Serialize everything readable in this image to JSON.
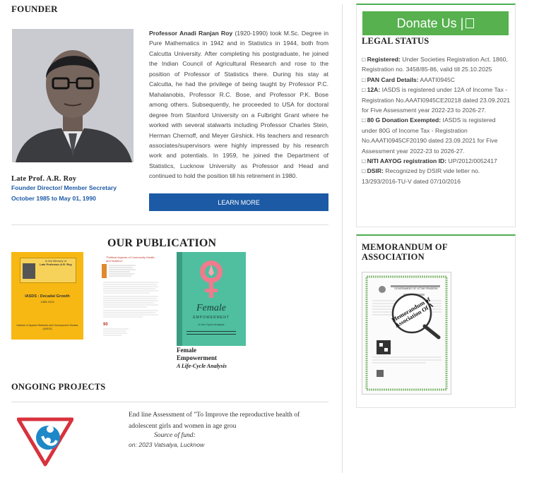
{
  "founder": {
    "heading": "FOUNDER",
    "name": "Late Prof. A.R. Roy",
    "role": "Founder Director/ Member Secretary",
    "tenure": "October 1985 to May 01, 1990",
    "bio_name": "Professor Anadi Ranjan Roy",
    "bio_text": " (1920-1990) took M.Sc. Degree in Pure Mathematics in 1942 and in Statistics in 1944, both from Calcutta University. After completing his postgraduate, he joined the Indian Council of Agricultural Research and rose to the position of Professor of Statistics there. During his stay at Calcutta, he had the privilege of being taught by Professor P.C. Mahalanobis, Professor R.C. Bose, and Professor P.K. Bose among others. Subsequently, he proceeded to USA for doctoral degree from Stanford University on a Fulbright Grant where he worked with several stalwarts including Professor Charles Stein, Herman Chernoff, and Meyer Girshick. His teachers and research associates/supervisors were highly impressed by his research work and potentials. In 1959, he joined the Department of Statistics, Lucknow University as Professor and Head and continued to hold the position till his retirement in 1980.",
    "learn_more": "LEARN MORE"
  },
  "publication": {
    "heading": "OUR PUBLICATION",
    "book1": {
      "line1": "In the Memory of",
      "line2": "Late Professor A.R. Roy",
      "title": "IASDS : Decadal Growth",
      "years": "1985-2015",
      "publisher": "Institute of Applied Statistics and Development Studies (IASDS)"
    },
    "book2": {
      "title": "\"Political Aspects of Community Health and Nutrition\""
    },
    "book3": {
      "cover_title": "Female",
      "cover_sub": "EMPOWERMENT",
      "cover_tag": "A Life Cycle Analysis",
      "caption_line1": "Female",
      "caption_line2": "Empowerment",
      "caption_line3": "A Life-Cycle Analysis"
    }
  },
  "projects": {
    "heading": "ONGOING PROJECTS",
    "item_title": "End line Assessment of \"To Improve the reproductive health of adolescent girls and women in age grou",
    "fund_label": "Source of fund:",
    "fund_value": "on: 2023 Vatsalya, Lucknow"
  },
  "donate": {
    "label": "Donate Us |",
    "icon": "heart-icon"
  },
  "legal": {
    "heading": "LEGAL STATUS",
    "items": [
      {
        "label": "Registered:",
        "text": " Under Societies Registration Act. 1860, Registration no. 3458/85-86, valid till 25.10.2025"
      },
      {
        "label": "PAN Card Details:",
        "text": " AAATI0945C"
      },
      {
        "label": "12A:",
        "text": " IASDS is registered under 12A of Income Tax - Registration No.AAATI0945CE20218 dated 23.09.2021 for Five Assessment year 2022-23 to 2026-27."
      },
      {
        "label": "80 G Donation Exempted:",
        "text": " IASDS is registered under 80G of Income Tax - Registration No.AAATI0945CF20190 dated 23.09.2021 for Five Assessment year 2022-23 to 2026-27."
      },
      {
        "label": "NITI AAYOG registration ID:",
        "text": " UP/2012/0052417"
      },
      {
        "label": "DSIR:",
        "text": " Recognized by DSIR vide letter no. 13/293/2016-TU-V dated 07/10/2016"
      }
    ],
    "bullet": "□"
  },
  "memo": {
    "heading": "MEMORANDUM OF ASSOCIATION",
    "doc_header": "GOVERNMENT OF UTTAR PRADESH",
    "stamp_text": "Memorandum of Association Of A"
  }
}
